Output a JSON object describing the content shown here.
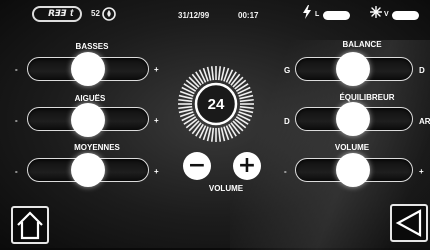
{
  "status": {
    "logo_text": "RƎƎ",
    "logo_suffix": "t",
    "temperature": "52",
    "temperature_icon": "droplet-icon",
    "date": "31/12/99",
    "time": "00:17",
    "battery_icon": "bolt-icon",
    "battery_flag": "L",
    "light_icon": "sun-icon",
    "light_flag": "V"
  },
  "left_sliders": [
    {
      "label": "BASSES",
      "min_symbol": "-",
      "max_symbol": "+",
      "value_fraction": 0.5
    },
    {
      "label": "AIGUËS",
      "min_symbol": "-",
      "max_symbol": "+",
      "value_fraction": 0.5
    },
    {
      "label": "MOYENNES",
      "min_symbol": "-",
      "max_symbol": "+",
      "value_fraction": 0.5
    }
  ],
  "right_sliders": [
    {
      "label": "BALANCE",
      "min_symbol": "G",
      "max_symbol": "D",
      "value_fraction": 0.5
    },
    {
      "label": "ÉQUILIBREUR",
      "min_symbol": "D",
      "max_symbol": "AR",
      "value_fraction": 0.5
    },
    {
      "label": "VOLUME",
      "min_symbol": "-",
      "max_symbol": "+",
      "value_fraction": 0.5
    }
  ],
  "volume": {
    "value": "24",
    "minus_label": "−",
    "plus_label": "+",
    "label": "VOLUME"
  },
  "nav": {
    "home_icon": "home-icon",
    "back_icon": "back-triangle-icon"
  },
  "colors": {
    "background": "#1c1c1c",
    "accent": "#ffffff"
  }
}
